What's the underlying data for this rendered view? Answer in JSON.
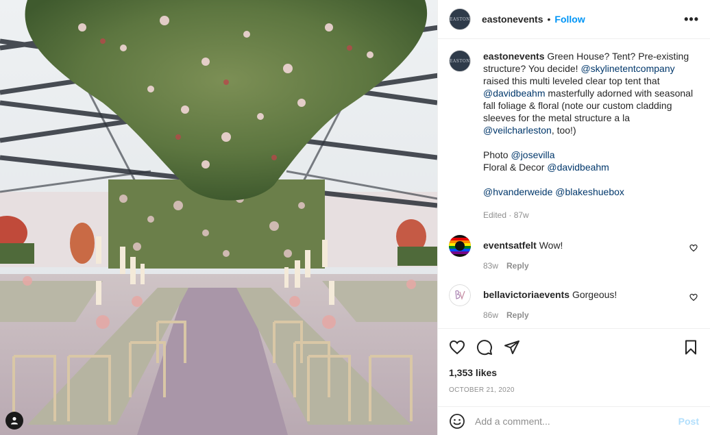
{
  "post": {
    "username": "eastonevents",
    "avatar_text": "EASTON",
    "follow_label": "Follow",
    "separator": "•",
    "more_label": "•••"
  },
  "caption": {
    "username": "eastonevents",
    "text_1": " Green House? Tent? Pre-existing structure? You decide! ",
    "mention_1": "@skylinetentcompany",
    "text_2": " raised this multi leveled clear top tent that ",
    "mention_2": "@davidbeahm",
    "text_3": " masterfully adorned with seasonal fall foliage & floral (note our custom cladding sleeves for the metal structure a la ",
    "mention_3": "@veilcharleston",
    "text_4": ", too!)",
    "photo_label": "Photo ",
    "mention_4": "@josevilla",
    "floral_label": "Floral & Decor ",
    "mention_5": "@davidbeahm",
    "mention_6": "@hvanderweide",
    "mention_7": "@blakeshuebox",
    "edited": "Edited",
    "meta_sep": " · ",
    "time": "87w"
  },
  "comments": [
    {
      "username": "eventsatfelt",
      "text": "Wow!",
      "time": "83w",
      "reply_label": "Reply"
    },
    {
      "username": "bellavictoriaevents",
      "text": "Gorgeous!",
      "time": "86w",
      "reply_label": "Reply"
    }
  ],
  "actions": {
    "likes": "1,353 likes",
    "date": "October 21, 2020"
  },
  "add_comment": {
    "placeholder": "Add a comment...",
    "post_label": "Post"
  },
  "colors": {
    "accent": "#0095f6",
    "mention": "#00376b",
    "muted": "#8e8e8e",
    "post_disabled": "#b2dffc"
  }
}
